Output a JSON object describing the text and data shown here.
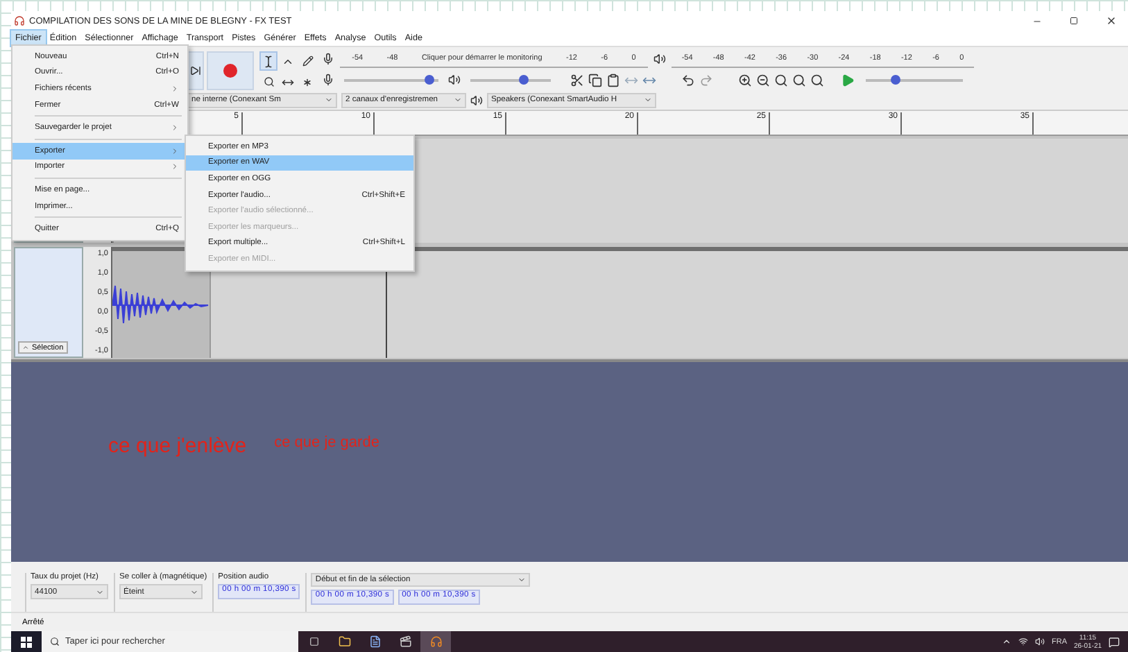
{
  "window": {
    "title": "COMPILATION DES SONS DE LA MINE DE BLEGNY - FX TEST"
  },
  "menubar": [
    {
      "label": "Fichier",
      "selected": true
    },
    {
      "label": "Édition",
      "selected": false
    },
    {
      "label": "Sélectionner",
      "selected": false
    },
    {
      "label": "Affichage",
      "selected": false
    },
    {
      "label": "Transport",
      "selected": false
    },
    {
      "label": "Pistes",
      "selected": false
    },
    {
      "label": "Générer",
      "selected": false
    },
    {
      "label": "Effets",
      "selected": false
    },
    {
      "label": "Analyse",
      "selected": false
    },
    {
      "label": "Outils",
      "selected": false
    },
    {
      "label": "Aide",
      "selected": false
    }
  ],
  "file_menu": [
    {
      "kind": "item",
      "label": "Nouveau",
      "shortcut": "Ctrl+N",
      "submenu": false,
      "selected": false
    },
    {
      "kind": "item",
      "label": "Ouvrir...",
      "shortcut": "Ctrl+O",
      "submenu": false,
      "selected": false
    },
    {
      "kind": "item",
      "label": "Fichiers récents",
      "submenu": true,
      "selected": false
    },
    {
      "kind": "item",
      "label": "Fermer",
      "shortcut": "Ctrl+W",
      "submenu": false,
      "selected": false
    },
    {
      "kind": "separator"
    },
    {
      "kind": "item",
      "label": "Sauvegarder le projet",
      "submenu": true,
      "selected": false
    },
    {
      "kind": "separator"
    },
    {
      "kind": "item",
      "label": "Exporter",
      "submenu": true,
      "selected": true
    },
    {
      "kind": "item",
      "label": "Importer",
      "submenu": true,
      "selected": false
    },
    {
      "kind": "separator"
    },
    {
      "kind": "item",
      "label": "Mise en page...",
      "submenu": false,
      "selected": false
    },
    {
      "kind": "item",
      "label": "Imprimer...",
      "submenu": false,
      "selected": false
    },
    {
      "kind": "separator"
    },
    {
      "kind": "item",
      "label": "Quitter",
      "shortcut": "Ctrl+Q",
      "submenu": false,
      "selected": false
    }
  ],
  "export_menu": [
    {
      "label": "Exporter en MP3",
      "selected": false,
      "disabled": false
    },
    {
      "label": "Exporter en WAV",
      "selected": true,
      "disabled": false
    },
    {
      "label": "Exporter en OGG",
      "selected": false,
      "disabled": false
    },
    {
      "label": "Exporter l'audio...",
      "shortcut": "Ctrl+Shift+E",
      "selected": false,
      "disabled": false
    },
    {
      "label": "Exporter l'audio sélectionné...",
      "selected": false,
      "disabled": true
    },
    {
      "label": "Exporter les marqueurs...",
      "selected": false,
      "disabled": true
    },
    {
      "label": "Export multiple...",
      "shortcut": "Ctrl+Shift+L",
      "selected": false,
      "disabled": false
    },
    {
      "label": "Exporter en MIDI...",
      "selected": false,
      "disabled": true
    }
  ],
  "recording_meter": {
    "ticks": [
      "-54",
      "-48"
    ],
    "hint": "Cliquer pour démarrer le monitoring",
    "ticks_end": [
      "-12",
      "-6",
      "0"
    ]
  },
  "playback_meter": {
    "ticks": [
      "-54",
      "-48",
      "-42",
      "-36",
      "-30",
      "-24",
      "-18",
      "-12",
      "-6",
      "0"
    ]
  },
  "recording_volume": {
    "level": 0.9
  },
  "playback_volume": {
    "level": 0.65
  },
  "play_speed": {
    "level": 0.3
  },
  "devices": {
    "input": "ne interne (Conexant Sm",
    "channels": "2 canaux d'enregistremen",
    "output": "Speakers (Conexant SmartAudio H"
  },
  "ruler": [
    "5",
    "10",
    "15",
    "20",
    "25",
    "30",
    "35"
  ],
  "track": {
    "scale": [
      "1,0",
      "1,0",
      "0,5",
      "0,0",
      "-0,5",
      "-1,0"
    ],
    "select_button": "Sélection"
  },
  "annotations": [
    {
      "kind": "large",
      "text": "ce que j'enlève"
    },
    {
      "kind": "small",
      "text": "ce que je garde"
    }
  ],
  "selection_toolbar": {
    "rate_label": "Taux du projet (Hz)",
    "rate": "44100",
    "snap_label": "Se coller à (magnétique)",
    "snap": "Éteint",
    "position_label": "Position audio",
    "position": "00 h 00 m 10,390 s",
    "range_label": "Début et fin de la sélection",
    "start": "00 h 00 m 10,390 s",
    "end": "00 h 00 m 10,390 s"
  },
  "status": "Arrêté",
  "taskbar": {
    "search_placeholder": "Taper ici pour rechercher",
    "language": "FRA",
    "time": "11:15",
    "date": "26-01-21"
  }
}
